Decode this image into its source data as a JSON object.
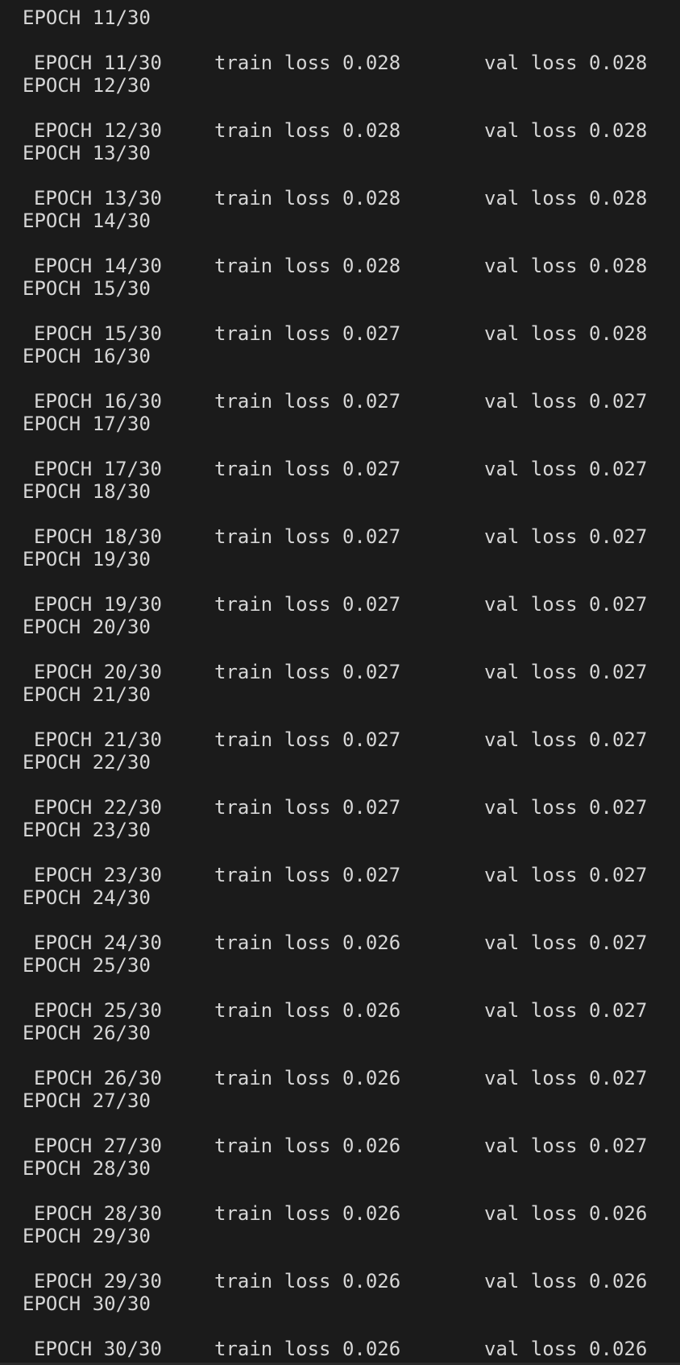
{
  "terminal": {
    "first_header": "EPOCH 11/30",
    "rows": [
      {
        "epoch": "EPOCH 11/30",
        "train": "train loss 0.028",
        "val": "val loss 0.028",
        "next": "EPOCH 12/30"
      },
      {
        "epoch": "EPOCH 12/30",
        "train": "train loss 0.028",
        "val": "val loss 0.028",
        "next": "EPOCH 13/30"
      },
      {
        "epoch": "EPOCH 13/30",
        "train": "train loss 0.028",
        "val": "val loss 0.028",
        "next": "EPOCH 14/30"
      },
      {
        "epoch": "EPOCH 14/30",
        "train": "train loss 0.028",
        "val": "val loss 0.028",
        "next": "EPOCH 15/30"
      },
      {
        "epoch": "EPOCH 15/30",
        "train": "train loss 0.027",
        "val": "val loss 0.028",
        "next": "EPOCH 16/30"
      },
      {
        "epoch": "EPOCH 16/30",
        "train": "train loss 0.027",
        "val": "val loss 0.027",
        "next": "EPOCH 17/30"
      },
      {
        "epoch": "EPOCH 17/30",
        "train": "train loss 0.027",
        "val": "val loss 0.027",
        "next": "EPOCH 18/30"
      },
      {
        "epoch": "EPOCH 18/30",
        "train": "train loss 0.027",
        "val": "val loss 0.027",
        "next": "EPOCH 19/30"
      },
      {
        "epoch": "EPOCH 19/30",
        "train": "train loss 0.027",
        "val": "val loss 0.027",
        "next": "EPOCH 20/30"
      },
      {
        "epoch": "EPOCH 20/30",
        "train": "train loss 0.027",
        "val": "val loss 0.027",
        "next": "EPOCH 21/30"
      },
      {
        "epoch": "EPOCH 21/30",
        "train": "train loss 0.027",
        "val": "val loss 0.027",
        "next": "EPOCH 22/30"
      },
      {
        "epoch": "EPOCH 22/30",
        "train": "train loss 0.027",
        "val": "val loss 0.027",
        "next": "EPOCH 23/30"
      },
      {
        "epoch": "EPOCH 23/30",
        "train": "train loss 0.027",
        "val": "val loss 0.027",
        "next": "EPOCH 24/30"
      },
      {
        "epoch": "EPOCH 24/30",
        "train": "train loss 0.026",
        "val": "val loss 0.027",
        "next": "EPOCH 25/30"
      },
      {
        "epoch": "EPOCH 25/30",
        "train": "train loss 0.026",
        "val": "val loss 0.027",
        "next": "EPOCH 26/30"
      },
      {
        "epoch": "EPOCH 26/30",
        "train": "train loss 0.026",
        "val": "val loss 0.027",
        "next": "EPOCH 27/30"
      },
      {
        "epoch": "EPOCH 27/30",
        "train": "train loss 0.026",
        "val": "val loss 0.027",
        "next": "EPOCH 28/30"
      },
      {
        "epoch": "EPOCH 28/30",
        "train": "train loss 0.026",
        "val": "val loss 0.026",
        "next": "EPOCH 29/30"
      },
      {
        "epoch": "EPOCH 29/30",
        "train": "train loss 0.026",
        "val": "val loss 0.026",
        "next": "EPOCH 30/30"
      },
      {
        "epoch": "EPOCH 30/30",
        "train": "train loss 0.026",
        "val": "val loss 0.026",
        "next": ""
      }
    ]
  },
  "colors": {
    "background": "#1b1b1b",
    "text": "#d6d6d6"
  }
}
